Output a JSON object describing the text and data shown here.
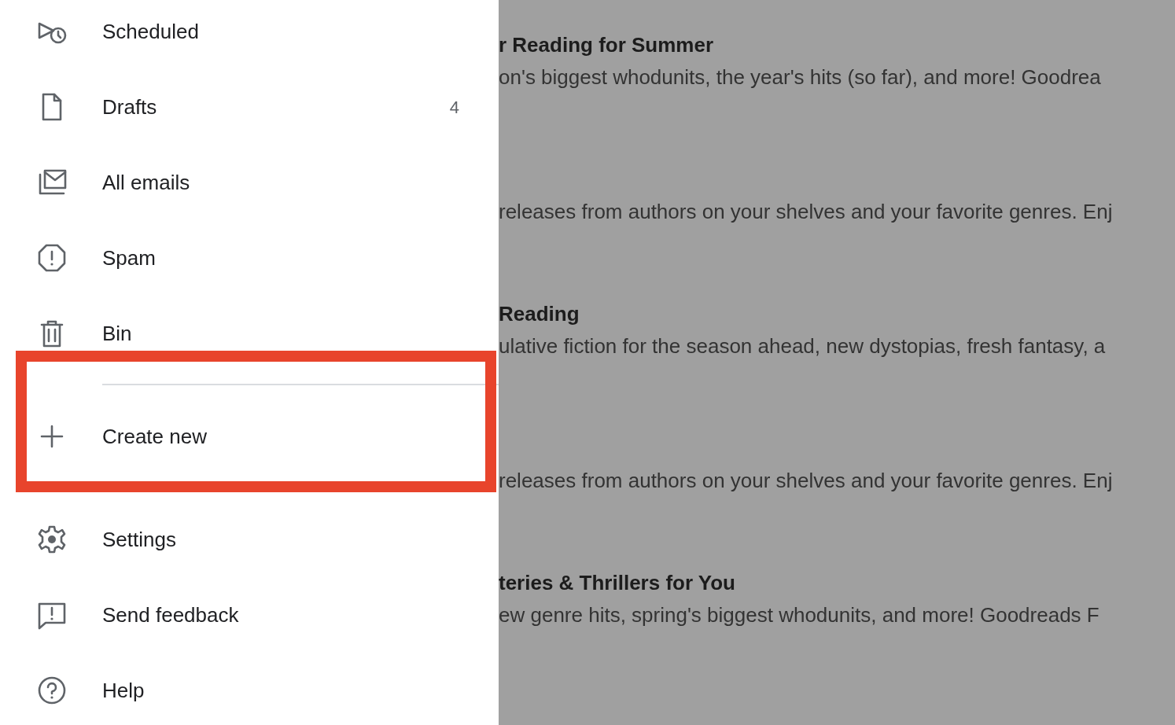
{
  "drawer": {
    "folders": [
      {
        "label": "Scheduled"
      },
      {
        "label": "Drafts",
        "count": "4"
      },
      {
        "label": "All emails"
      },
      {
        "label": "Spam"
      },
      {
        "label": "Bin"
      }
    ],
    "create": {
      "label": "Create new",
      "highlighted": true
    },
    "footer": [
      {
        "label": "Settings"
      },
      {
        "label": "Send feedback"
      },
      {
        "label": "Help"
      }
    ]
  },
  "emails": [
    {
      "title": "r Reading for Summer",
      "snippet": "on's biggest whodunits, the year's hits (so far), and more! Goodrea"
    },
    {
      "snippet": "releases from authors on your shelves and your favorite genres. Enj"
    },
    {
      "title": "Reading",
      "snippet": "ulative fiction for the season ahead, new dystopias, fresh fantasy, a"
    },
    {
      "snippet": "releases from authors on your shelves and your favorite genres. Enj"
    },
    {
      "title": "teries & Thrillers for You",
      "snippet": "ew genre hits, spring's biggest whodunits, and more! Goodreads F"
    }
  ]
}
